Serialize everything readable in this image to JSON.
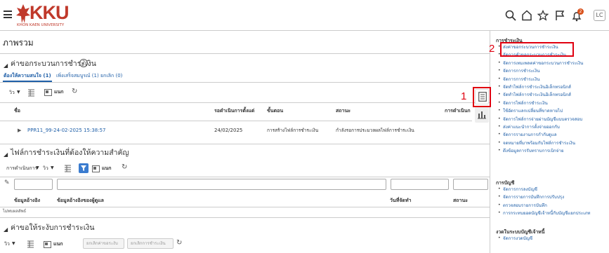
{
  "brand": {
    "logo_text": "KKU",
    "subtitle": "KHON KAEN UNIVERSITY"
  },
  "header": {
    "notif_count": "2",
    "avatar": "LC"
  },
  "page_title": "ภาพรวม",
  "section1": {
    "title": "ค่าขอกระบวนการชำระเงิน",
    "tabs": [
      "ต้องให้ความสนใจ (1)",
      "เพิ่งเสร็จสมบูรณ์ (1)",
      "ยกเลิก (0)"
    ],
    "view_label": "วิว",
    "detach_label": "แนก",
    "columns": [
      "ชื่อ",
      "รอดำเนินการตั้งแต่",
      "ขั้นตอน",
      "สถานะ",
      "การดำเนินก"
    ],
    "row": {
      "name": "PPR11_99-24-02-2025 15:38:57",
      "date": "24/02/2025",
      "step": "การสร้างไฟล์การชำระเงิน",
      "status": "กำลังรอการประมวลผลไฟล์การชำระเงิน"
    }
  },
  "section2": {
    "title": "ไฟล์การชำระเงินที่ต้องให้ความสำคัญ",
    "actions_label": "การดำเนินการ",
    "view_label": "วิว",
    "detach_label": "แนก",
    "columns": [
      "ข้อมูลอ้างอิง",
      "ข้อมูลอ้างอิงของผู้ดูแล",
      "วันที่จัดทำ",
      "สถานะ"
    ],
    "empty_text": "ไม่พบผลลัพธ์"
  },
  "section3": {
    "title": "ค่าขอให้ระงับการชำระเงิน",
    "view_label": "วิว",
    "detach_label": "แนก",
    "btn_cancel_select": "ยกเลิกค่าขอระงับ",
    "btn_cancel_payment": "ยกเลิกการชำระเงิน"
  },
  "sidebar": {
    "payments_heading": "การชำระเงิน",
    "payment_links": [
      "ส่งค่าขอกระบวนการชำระเงิน",
      "จัดการคำขอกระบวนการชำระเงิน",
      "จัดการเทมเพลตค่าขอกระบวนการชำระเงิน",
      "จัดการการชำระเงิน",
      "จัดการการชำระเงิน",
      "จัดทำไฟล์การชำระเงินอิเล็กทรอนิกส์",
      "จัดทำไฟล์การชำระเงินอิเล็กทรอนิกส์",
      "จัดการไฟล์การชำระเงิน",
      "ใช้อัตราแลกเปลี่ยนที่ขาดหายไป",
      "จัดการไฟล์การจ่ายผ่านบัญชีแบบตรวจสอบ",
      "ส่งค่าแนะนำการตั้งจ่ายออกกับ",
      "จัดการรายงานการกำกับดูแล",
      "จดหมายที่มาพร้อมกับไฟล์การชำระเงิน",
      "ดึงข้อมูลการรับทราบการเบิกจ่าย"
    ],
    "accounting_heading": "การบัญชี",
    "accounting_links": [
      "จัดการการลงบัญชี",
      "จัดการรายการบันทึกการปรับปรุง",
      "ตรวจสอบรายการบันทึก",
      "การกระทบยอดบัญชีเจ้าหนี้กับบัญชีแยกประเภท"
    ],
    "budget_heading": "งวดในระบบบัญชีเจ้าหนี้",
    "budget_links": [
      "จัดการงวดบัญชี"
    ]
  },
  "annotations": {
    "label1": "1",
    "label2": "2"
  },
  "colors": {
    "accent": "#1f5fa8",
    "annotation": "#e00010",
    "brand": "#c0392b"
  }
}
